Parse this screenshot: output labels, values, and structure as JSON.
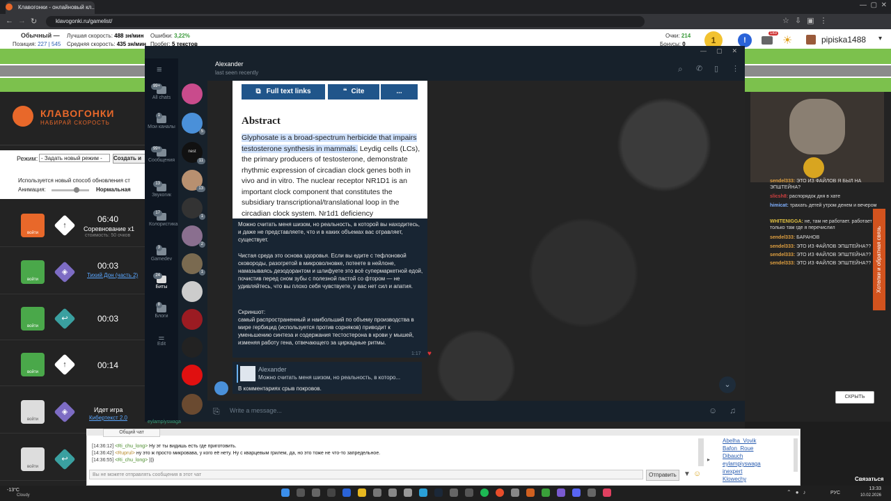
{
  "browser": {
    "tab_title": "Клавогонки - онлайновый кл...",
    "url": "klavogonki.ru/gamelist/"
  },
  "site": {
    "stats": {
      "mode_name": "Обычный —",
      "best_speed_label": "Лучшая скорость:",
      "best_speed_value": "488 зн/мин",
      "errors_label": "Ошибки:",
      "errors_value": "3,22%",
      "points_label": "Очки:",
      "points_value": "214",
      "position_label": "Позиция:",
      "position_value": "227 | 545",
      "avg_speed_label": "Средняя скорость:",
      "avg_speed_value": "435 зн/мин",
      "mileage_label": "Пробег:",
      "mileage_value": "5 текстов",
      "bonuses_label": "Бонусы:",
      "bonuses_value": "0",
      "level": "1",
      "notif_count": "183",
      "username": "pipiska1488"
    },
    "logo": {
      "title": "КЛАВОГОНКИ",
      "subtitle": "НАБИРАЙ СКОРОСТЬ"
    },
    "mode_label": "Режим:",
    "mode_select": "- Задать новый режим -",
    "create_button": "Создать и",
    "notice": "Используется новый способ обновления ст",
    "animation_label": "Анимация:",
    "animation_value": "Нормальная",
    "join_label": "войти",
    "games": [
      {
        "time": "06:40",
        "title": "Соревнование x1",
        "note": "стоимость: 50 очков",
        "icon": "↑"
      },
      {
        "time": "00:03",
        "title": "Тихий Дон (часть 2)",
        "icon": "◈"
      },
      {
        "time": "00:03",
        "icon": "↩"
      },
      {
        "time": "00:14",
        "icon": "↑"
      },
      {
        "title": "Идет игра",
        "link": "Кибертекст 2.0",
        "icon": "◈"
      }
    ],
    "hide_button": "СКРЫТЬ",
    "side_banner": "Хотелки и обратная связь"
  },
  "telegram": {
    "contact_name": "Alexander",
    "contact_status": "last seen recently",
    "nav": [
      {
        "label": "All chats",
        "badge": "99+"
      },
      {
        "label": "Мои каналы",
        "badge": "1"
      },
      {
        "label": "Сообщения",
        "badge": "99+"
      },
      {
        "label": "Звукогик",
        "badge": "13"
      },
      {
        "label": "Колористика",
        "badge": "17"
      },
      {
        "label": "Gamedev",
        "badge": "3"
      },
      {
        "label": "Биты",
        "badge": "24"
      },
      {
        "label": "Блоги",
        "badge": "8"
      },
      {
        "label": "Edit",
        "badge": ""
      }
    ],
    "chat_badges": [
      "",
      "5",
      "11",
      "13",
      "1",
      "2",
      "1"
    ],
    "chat_nest_label": "nest",
    "article": {
      "btn_full_text": "Full text links",
      "btn_cite": "Cite",
      "btn_more": "...",
      "heading": "Abstract",
      "highlighted": "Glyphosate is a broad-spectrum herbicide that impairs testosterone synthesis in mammals.",
      "rest": " Leydig cells (LCs), the primary producers of testosterone, demonstrate rhythmic expression of circadian clock genes both in vivo and in vitro. The nuclear receptor NR1D1 is an important clock component that constitutes the subsidiary transcriptional/translational loop in the circadian clock system. Nr1d1 deficiency"
    },
    "message": {
      "p1": "Можно считать меня шизом, но реальность, в которой вы находитесь, и даже не представляете, что и в каких объемах вас отравляет, существует.",
      "p2": "Чистая среда это основа здоровья. Если вы едите с тефлоновой сковороды, разогретой в микроволновке, потеете в нейлоне, намазываясь дезодорантом и шлифуете это всё супермаркетной едой, почистив перед сном зубы с полезной пастой со фтором — не удивляйтесь, что вы плохо себя чувствуете, у вас нет сил и апатия.",
      "p3_label": "Скриншот:",
      "p3": "самый распространенный и наибольший по объему производства в мире гербицид (используется против сорняков) приводит к уменьшению синтеза и содержания тестостерона в крови у мышей, изменяя работу гена, отвечающего за циркадные ритмы.",
      "time": "1:17",
      "reaction": "♥"
    },
    "reply": {
      "author": "Alexander",
      "preview": "Можно считать меня шизом, но реальность, в которо...",
      "text": "В комментариях срыв покровов."
    },
    "input_placeholder": "Write a message..."
  },
  "stream_chat": [
    {
      "name": "sendel333:",
      "text": "ЭТО ИЗ ФАЙЛОВ Я БЫЛ НА ЭПШТЕЙНА?",
      "color": "#e0a040"
    },
    {
      "name": "slicsh8:",
      "text": "распорядок дня в хате",
      "color": "#d04040"
    },
    {
      "name": "himicat:",
      "text": "трахать детей утром денем и вечером",
      "color": "#7fb0ff"
    },
    {
      "name": "WHITENIGGA:",
      "text": "не, там не работает. работает только там где я перечислил",
      "color": "#e0c040"
    },
    {
      "name": "sendel333:",
      "text": "БАРАНОВ",
      "color": "#e0a040"
    },
    {
      "name": "sendel333:",
      "text": "ЭТО ИЗ ФАЙЛОВ ЭПШТЕЙНА??",
      "color": "#e0a040"
    },
    {
      "name": "sendel333:",
      "text": "ЭТО ИЗ ФАЙЛОВ ЭПШТЕЙНА??",
      "color": "#e0a040"
    },
    {
      "name": "sendel333:",
      "text": "ЭТО ИЗ ФАЙЛОВ ЭПШТЕЙНА??",
      "color": "#e0a040"
    }
  ],
  "general_chat": {
    "tab": "Общий чат",
    "lines": [
      {
        "time": "[14:36:12]",
        "nick": "<Ri_chu_long>",
        "text": "Ну эт ты видишь есть где приготовить."
      },
      {
        "time": "[14:36:42]",
        "nick": "<Ruprul>",
        "text": "ну это ж просто микровава, у кого её нету. Ну с кварцевым грилем, да, но это тоже не что-то запредельное."
      },
      {
        "time": "[14:36:55]",
        "nick": "<Ri_chu_long>",
        "text": ")))"
      }
    ],
    "input_placeholder": "Вы не можете отправлять сообщения в этот чат",
    "send_button": "Отправить",
    "users": [
      "Abelha_Vovik",
      "Bafon_Roue",
      "Dibauch",
      "eylampiyswaga",
      "inexpert",
      "Klowechy"
    ],
    "below_user": "eylampiyswaga",
    "contact_link": "Связаться"
  },
  "taskbar": {
    "weather_temp": "-13°C",
    "weather_desc": "Cloudy",
    "lang": "РУС",
    "time": "13:33",
    "date": "10.02.2026"
  }
}
